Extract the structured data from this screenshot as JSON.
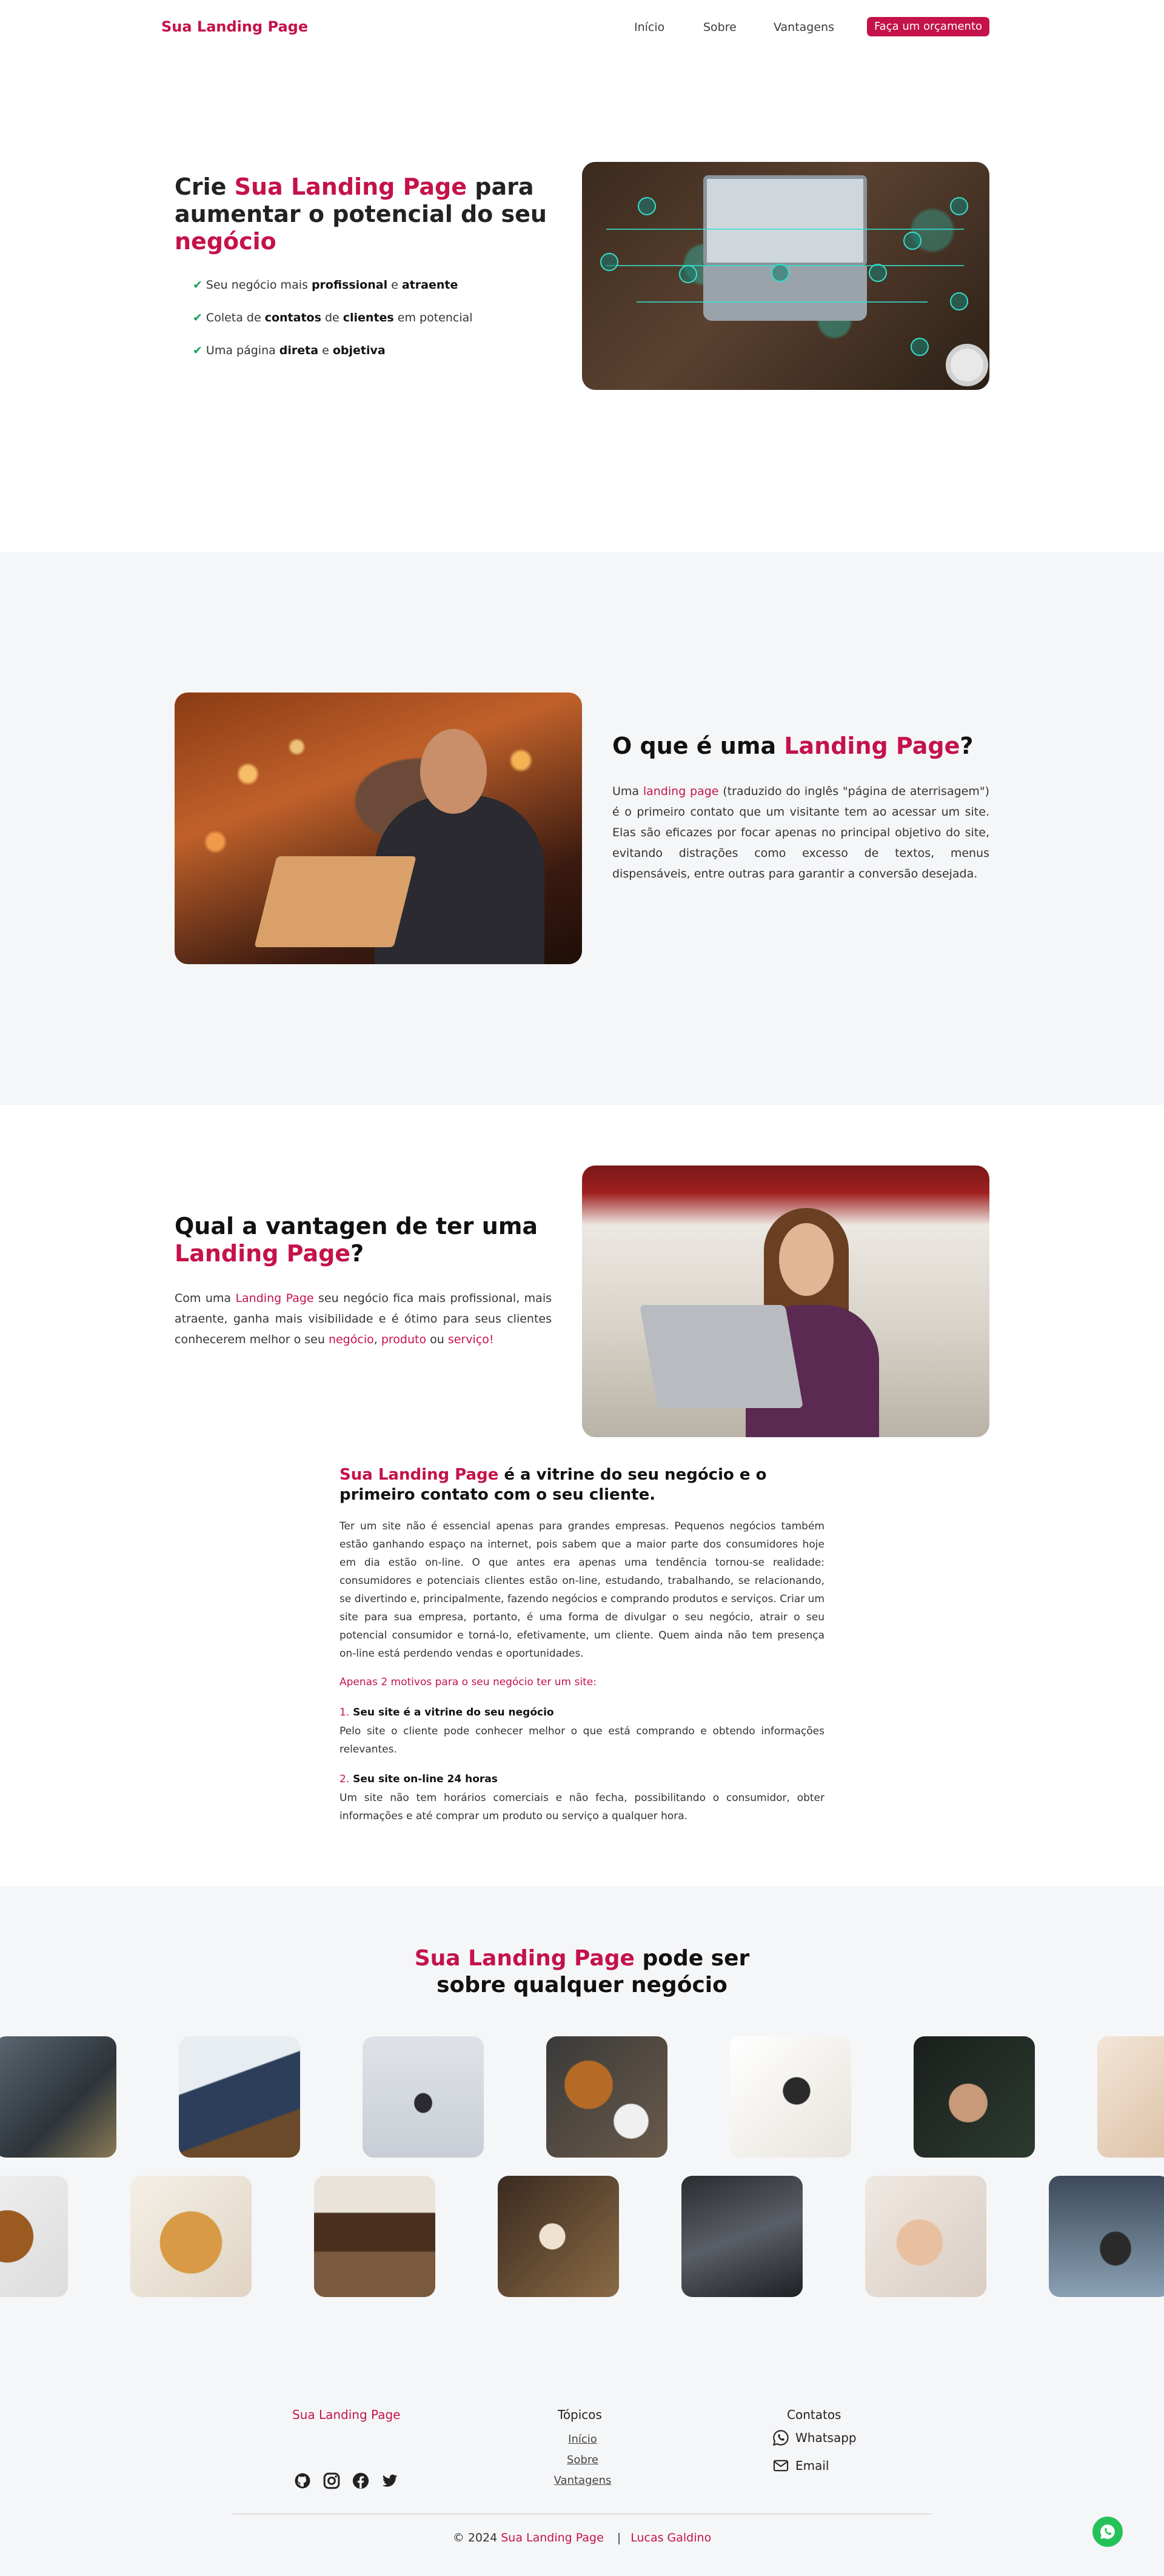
{
  "nav": {
    "brand": "Sua Landing Page",
    "links": [
      "Início",
      "Sobre",
      "Vantagens"
    ],
    "cta": "Faça um orçamento"
  },
  "hero": {
    "title_pre": "Crie ",
    "title_accent": "Sua Landing Page",
    "title_mid": " para aumentar o potencial do seu ",
    "title_end": "negócio",
    "bullets": [
      {
        "pre": "Seu negócio mais ",
        "b1": "profissional",
        "mid": " e ",
        "b2": "atraente",
        "post": ""
      },
      {
        "pre": "Coleta de ",
        "b1": "contatos",
        "mid": " de ",
        "b2": "clientes",
        "post": " em potencial"
      },
      {
        "pre": "Uma página ",
        "b1": "direta",
        "mid": " e ",
        "b2": "objetiva",
        "post": ""
      }
    ]
  },
  "about": {
    "title_pre": "O que é uma ",
    "title_accent": "Landing Page",
    "title_end": "?",
    "para_pre": "Uma ",
    "para_accent": "landing page",
    "para_post": " (traduzido do inglês \"página de aterrisagem\") é o primeiro contato que um visitante tem ao acessar um site. Elas são eficazes por focar apenas no principal objetivo do site, evitando distrações como excesso de textos, menus dispensáveis, entre outras para garantir a conversão desejada."
  },
  "advantages": {
    "title_pre": "Qual a vantagen de ter uma ",
    "title_accent": "Landing Page",
    "title_end": "?",
    "para_pre": "Com uma ",
    "para_accent": "Landing Page",
    "para_mid": " seu negócio fica mais profissional, mais atraente, ganha mais visibilidade e é ótimo para seus clientes conhecerem melhor o seu ",
    "links": [
      "negócio",
      "produto",
      "serviço!"
    ],
    "sep1": ", ",
    "sep2": " ou "
  },
  "article": {
    "title_accent": "Sua Landing Page",
    "title_rest": " é a vitrine do seu negócio e o primeiro contato com o seu cliente.",
    "para": "Ter um site não é essencial apenas para grandes empresas. Pequenos negócios também estão ganhando espaço na internet, pois sabem que a maior parte dos consumidores hoje em dia estão on-line. O que antes era apenas uma tendência tornou-se realidade: consumidores e potenciais clientes estão on-line, estudando, trabalhando, se relacionando, se divertindo e, principalmente, fazendo negócios e comprando produtos e serviços. Criar um site para sua empresa, portanto, é uma forma de divulgar o seu negócio, atrair o seu potencial consumidor e torná-lo, efetivamente, um cliente. Quem ainda não tem presença on-line está perdendo vendas e oportunidades.",
    "motives": "Apenas 2 motivos para o seu negócio ter um site:",
    "reasons": [
      {
        "num": "1.",
        "title": "Seu site é a vitrine do seu negócio",
        "text": "Pelo site o cliente pode conhecer melhor o que está comprando e obtendo informações relevantes."
      },
      {
        "num": "2.",
        "title": "Seu site on-line 24 horas",
        "text": "Um site não tem horários comerciais e não fecha, possibilitando o consumidor, obter informações e até comprar um produto ou serviço a qualquer hora."
      }
    ]
  },
  "gallery": {
    "title_accent": "Sua Landing Page",
    "title_rest": " pode ser",
    "title_line2": "sobre qualquer negócio"
  },
  "footer": {
    "brand": "Sua Landing Page",
    "topics_title": "Tópicos",
    "topics": [
      "Início",
      "Sobre",
      "Vantagens"
    ],
    "contacts_title": "Contatos",
    "contacts": [
      "Whatsapp",
      "Email"
    ],
    "copy_pre": "© 2024 ",
    "copy_brand": "Sua Landing Page",
    "copy_sep": "|",
    "copy_author": "Lucas Galdino"
  },
  "colors": {
    "accent": "#c4124a",
    "section_gray": "#f5f6f8",
    "whatsapp": "#25c25a"
  }
}
